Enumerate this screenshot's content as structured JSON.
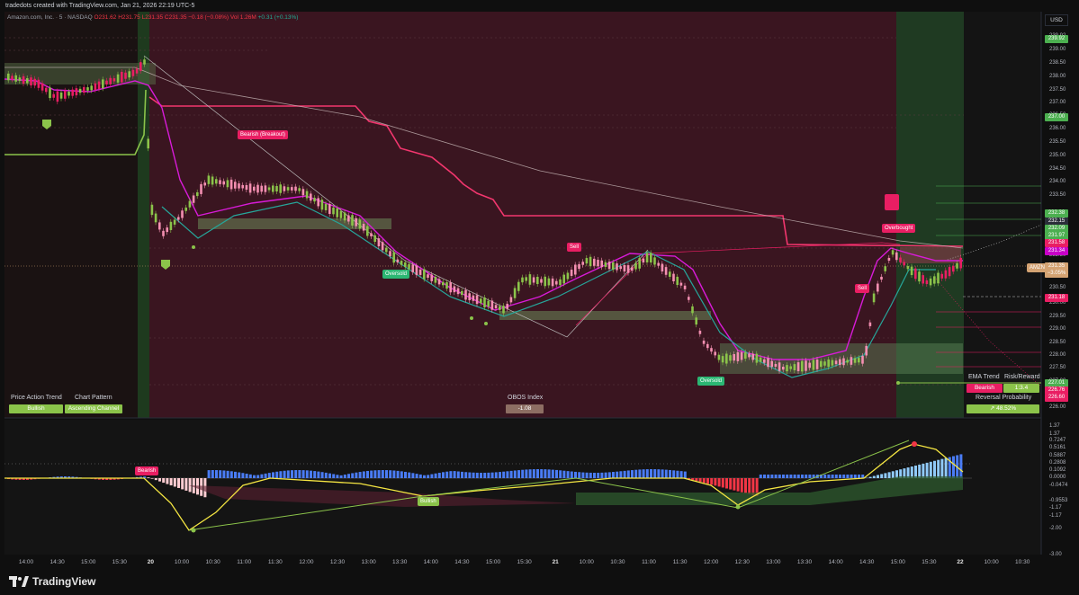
{
  "header": {
    "credit": "tradedots created with TradingView.com, Jan 21, 2026 22:19 UTC-5",
    "symbol_line": "Amazon.com, Inc. · 5 · NASDAQ",
    "ohlc": "O231.62 H231.75 L231.35 C231.35 −0.18 (−0.08%)",
    "volume": "Vol 1.26M",
    "change": "+0.31 (+0.13%)"
  },
  "currency_button": "USD",
  "price_axis": [
    "239.92",
    "239.00",
    "238.50",
    "238.00",
    "237.50",
    "237.00",
    "236.50",
    "236.00",
    "235.50",
    "235.00",
    "234.50",
    "234.00",
    "233.50",
    "232.50",
    "231.00",
    "230.50",
    "230.00",
    "229.50",
    "229.00",
    "228.50",
    "228.00",
    "227.50",
    "227.00",
    "226.50",
    "226.00"
  ],
  "price_tags": [
    {
      "label": "239.92",
      "color": "#4caf50"
    },
    {
      "label": "237.00",
      "color": "#4caf50"
    },
    {
      "label": "232.38",
      "color": "#4caf50"
    },
    {
      "label": "232.15",
      "color": "#2a2e39"
    },
    {
      "label": "232.09",
      "color": "#4caf50"
    },
    {
      "label": "231.97",
      "color": "#4caf50"
    },
    {
      "label": "231.58",
      "color": "#e91e63"
    },
    {
      "label": "231.34",
      "color": "#c800c8"
    },
    {
      "label": "231.35",
      "color": "#d4a373"
    },
    {
      "label": "−3.05%",
      "color": "#d4a373"
    },
    {
      "label": "231.18",
      "color": "#e91e63"
    },
    {
      "label": "227.01",
      "color": "#4caf50"
    },
    {
      "label": "226.76",
      "color": "#e91e63"
    },
    {
      "label": "226.60",
      "color": "#e91e63"
    }
  ],
  "symbol_tag": "AMZN",
  "signals": {
    "bearish_breakout": "Bearish (Breakout)",
    "sell_1": "Sell",
    "sell_2": "Sell",
    "overbought": "Overbought",
    "oversold_1": "Oversold",
    "oversold_2": "Oversold"
  },
  "left_table": {
    "h1": "Price Action Trend",
    "h2": "Chart Pattern",
    "v1": "Bullish",
    "v2": "Ascending Channel"
  },
  "obos": {
    "title": "OBOS Index",
    "value": "-1.08"
  },
  "right_table": {
    "h1": "EMA Trend",
    "h2": "Risk/Reward",
    "v1": "Bearish",
    "v2": "1:3.4",
    "h3": "Reversal Probability",
    "v3": "48.52%"
  },
  "osc_axis": [
    "1.37",
    "1.37",
    "0.7247",
    "0.5161",
    "0.5887",
    "0.2808",
    "0.1092",
    "0.0000",
    "-0.0474",
    "-0.9553",
    "-1.17",
    "-1.17",
    "-2.00",
    "-3.00"
  ],
  "osc_labels": {
    "bearish": "Bearish",
    "bullish": "Bullish"
  },
  "time_axis": [
    "14:00",
    "14:30",
    "15:00",
    "15:30",
    "20",
    "10:00",
    "10:30",
    "11:00",
    "11:30",
    "12:00",
    "12:30",
    "13:00",
    "13:30",
    "14:00",
    "14:30",
    "15:00",
    "15:30",
    "21",
    "10:00",
    "10:30",
    "11:00",
    "11:30",
    "12:00",
    "12:30",
    "13:00",
    "13:30",
    "14:00",
    "14:30",
    "15:00",
    "15:30",
    "22",
    "10:00",
    "10:30"
  ],
  "brand": "TradingView",
  "colors": {
    "bull": "#8bc34a",
    "bear": "#e91e63",
    "magenta": "#c800c8",
    "teal": "#26a69a"
  }
}
